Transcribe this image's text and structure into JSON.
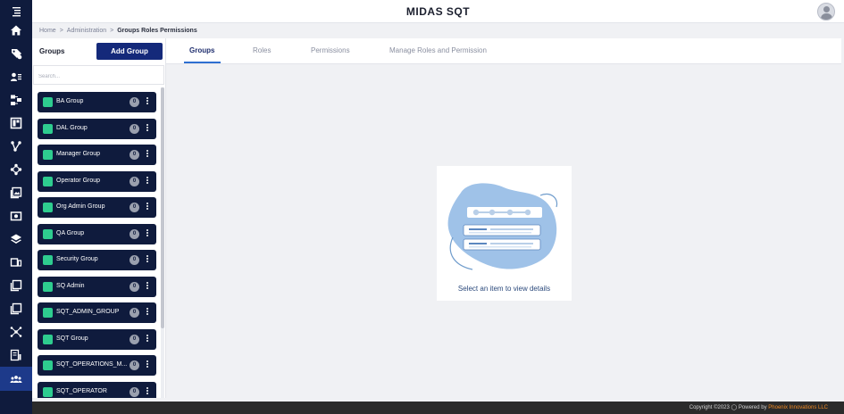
{
  "header": {
    "title": "MIDAS SQT"
  },
  "breadcrumb": {
    "home": "Home",
    "sep1": ">",
    "section": "Administration",
    "sep2": ">",
    "current": "Groups Roles Permissions"
  },
  "groups_panel": {
    "heading": "Groups",
    "add_button": "Add Group",
    "search_placeholder": "Search...",
    "items": [
      {
        "name": "BA Group",
        "count": "0"
      },
      {
        "name": "DAL Group",
        "count": "0"
      },
      {
        "name": "Manager Group",
        "count": "0"
      },
      {
        "name": "Operator Group",
        "count": "0"
      },
      {
        "name": "Org Admin Group",
        "count": "0"
      },
      {
        "name": "QA Group",
        "count": "0"
      },
      {
        "name": "Security Group",
        "count": "0"
      },
      {
        "name": "SQ Admin",
        "count": "0"
      },
      {
        "name": "SQT_ADMIN_GROUP",
        "count": "0"
      },
      {
        "name": "SQT Group",
        "count": "0"
      },
      {
        "name": "SQT_OPERATIONS_M...",
        "count": "0"
      },
      {
        "name": "SQT_OPERATOR",
        "count": "0"
      }
    ]
  },
  "tabs": [
    {
      "label": "Groups",
      "active": true
    },
    {
      "label": "Roles",
      "active": false
    },
    {
      "label": "Permissions",
      "active": false
    },
    {
      "label": "Manage Roles and Permission",
      "active": false
    }
  ],
  "empty_state": {
    "message": "Select an item to view details"
  },
  "footer": {
    "copyright": "Copyright ©2023",
    "powered": "Powered by",
    "company": "Phoenix Innovations LLC"
  },
  "rail_icons": [
    "menu-icon",
    "home-icon",
    "tag-icon",
    "users-list-icon",
    "hierarchy-icon",
    "dashboard-icon",
    "branch-icon",
    "network-icon",
    "gallery-icon",
    "camera-icon",
    "layers-icon",
    "device-icon",
    "copy-icon",
    "copy-alt-icon",
    "nodes-icon",
    "report-icon",
    "team-icon"
  ],
  "colors": {
    "rail": "#0f1b3d",
    "accent": "#14297a",
    "swatch": "#2ecc8f",
    "brand_footer": "#f08a24"
  }
}
